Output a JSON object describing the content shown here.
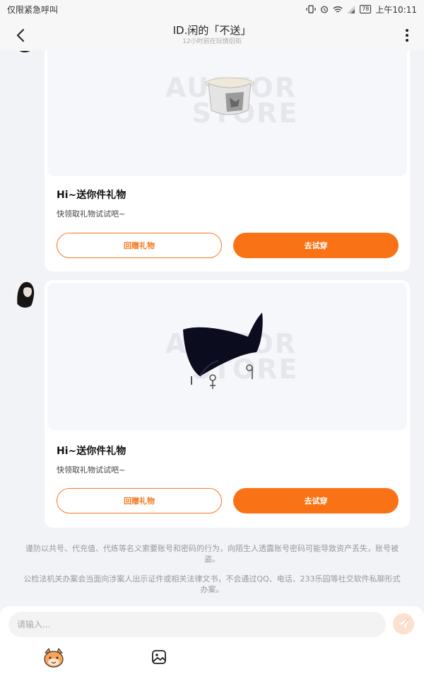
{
  "status_bar": {
    "carrier": "仅限紧急呼叫",
    "battery": "78",
    "time": "上午10:11"
  },
  "header": {
    "title": "ID.闲的「不送」",
    "subtitle": "12小时前在玩情侣街"
  },
  "messages": [
    {
      "watermark_top": "AUSTOR",
      "watermark_bottom": "STORE",
      "title": "Hi~送你件礼物",
      "description": "快领取礼物试试吧~",
      "return_label": "回赠礼物",
      "try_label": "去试穿"
    },
    {
      "watermark_top": "AUSTOR",
      "watermark_bottom": "STORE",
      "title": "Hi~送你件礼物",
      "description": "快领取礼物试试吧~",
      "return_label": "回赠礼物",
      "try_label": "去试穿"
    }
  ],
  "notices": [
    "谨防以共号、代充值、代练等名义索要账号和密码的行为，向陌生人透露账号密码可能导致资产丢失，账号被盗。",
    "公检法机关办案会当面向涉案人出示证件或相关法律文书，不会通过QQ、电话、233乐园等社交软件私聊形式办案。"
  ],
  "input": {
    "placeholder": "请输入..."
  },
  "icons": {
    "back": "chevron-left-icon",
    "more": "more-vertical-icon",
    "send": "send-icon",
    "emoji": "emoji-face-icon",
    "image": "image-icon"
  },
  "colors": {
    "accent": "#f97316",
    "background": "#f2f3f7"
  }
}
